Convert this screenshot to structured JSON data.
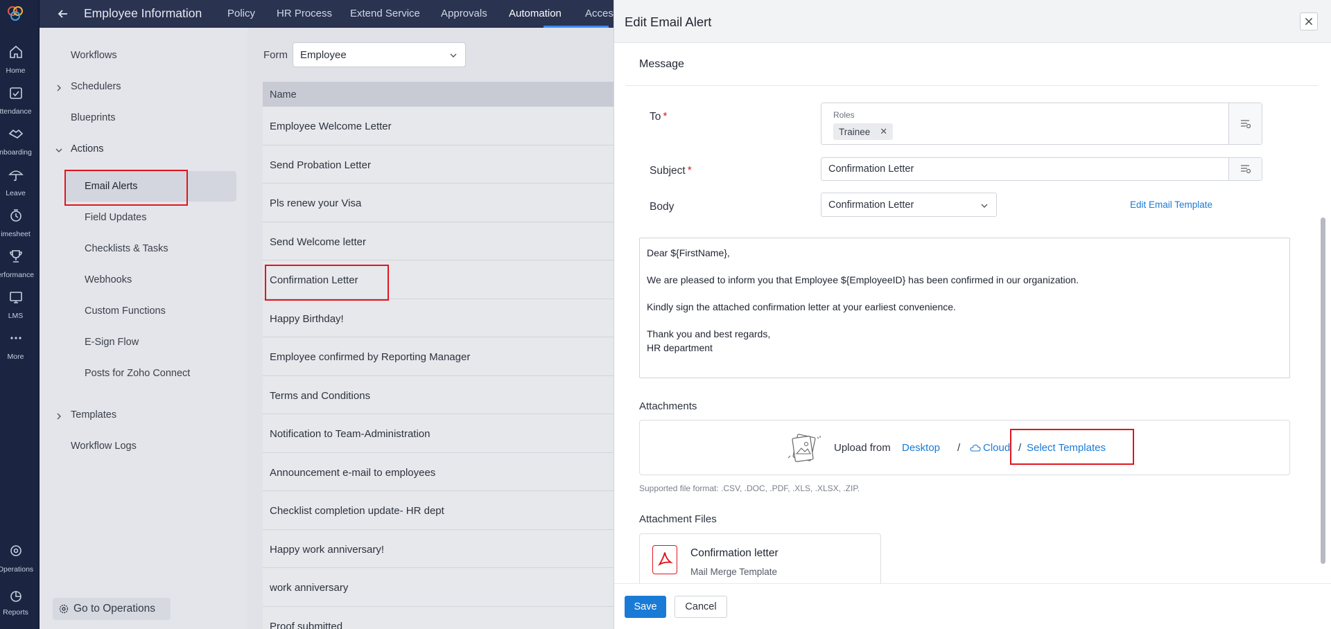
{
  "rail": {
    "items": [
      {
        "label": "Home",
        "icon": "home-icon"
      },
      {
        "label": "ttendance",
        "icon": "calendar-check-icon"
      },
      {
        "label": "nboarding",
        "icon": "handshake-icon"
      },
      {
        "label": "Leave",
        "icon": "umbrella-icon"
      },
      {
        "label": "imesheet",
        "icon": "timesheet-icon"
      },
      {
        "label": "erformance",
        "icon": "trophy-icon"
      },
      {
        "label": "LMS",
        "icon": "monitor-icon"
      },
      {
        "label": "More",
        "icon": "more-icon"
      },
      {
        "label": "Operations",
        "icon": "operations-icon"
      },
      {
        "label": "Reports",
        "icon": "reports-icon"
      }
    ]
  },
  "topbar": {
    "title": "Employee Information",
    "tabs": [
      "Policy",
      "HR Process",
      "Extend Service",
      "Approvals",
      "Automation",
      "Acces"
    ],
    "active_tab": "Automation"
  },
  "leftnav": {
    "workflows": "Workflows",
    "schedulers": "Schedulers",
    "blueprints": "Blueprints",
    "actions": "Actions",
    "email_alerts": "Email Alerts",
    "field_updates": "Field Updates",
    "checklists": "Checklists & Tasks",
    "webhooks": "Webhooks",
    "custom_functions": "Custom Functions",
    "esign_flow": "E-Sign Flow",
    "posts": "Posts for Zoho Connect",
    "templates": "Templates",
    "workflow_logs": "Workflow Logs",
    "go_to_operations": "Go to Operations"
  },
  "list": {
    "form_label": "Form",
    "form_value": "Employee",
    "column_header": "Name",
    "rows": [
      "Employee Welcome Letter",
      "Send Probation Letter",
      "Pls renew your Visa",
      "Send Welcome letter",
      "Confirmation Letter",
      "Happy Birthday!",
      "Employee confirmed by Reporting Manager",
      "Terms and Conditions",
      "Notification to Team-Administration",
      "Announcement e-mail to employees",
      "Checklist completion update- HR dept",
      "Happy work anniversary!",
      "work anniversary",
      "Proof submitted"
    ]
  },
  "panel": {
    "title": "Edit Email Alert",
    "section": "Message",
    "to_label": "To",
    "roles_label": "Roles",
    "roles_chip": "Trainee",
    "subject_label": "Subject",
    "subject_value": "Confirmation Letter",
    "body_label": "Body",
    "body_value": "Confirmation Letter",
    "edit_template": "Edit Email Template",
    "message_lines": [
      "Dear ${FirstName},",
      "We are pleased to inform you that Employee ${EmployeeID} has been confirmed in our organization.",
      "Kindly sign the attached confirmation letter at your earliest convenience.",
      "Thank you and best regards,",
      "HR department"
    ],
    "attachments_title": "Attachments",
    "upload_from": "Upload from",
    "desktop": "Desktop",
    "cloud": "Cloud",
    "select_templates": "Select Templates",
    "slash": "/",
    "supported": "Supported file format: .CSV, .DOC, .PDF, .XLS, .XLSX, .ZIP.",
    "attachment_files_title": "Attachment Files",
    "file_name": "Confirmation letter",
    "file_sub": "Mail Merge Template",
    "save": "Save",
    "cancel": "Cancel"
  },
  "colors": {
    "accent": "#1a7bd6",
    "highlight_box": "#e0151d",
    "rail_bg": "#1b2440",
    "topbar_bg": "#2a3350"
  }
}
